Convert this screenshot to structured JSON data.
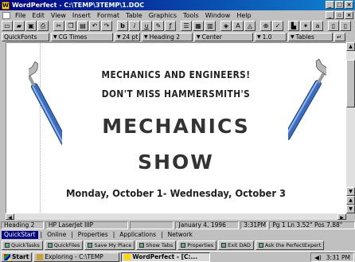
{
  "window": {
    "title": "WordPerfect - C:\\TEMP\\3TEMP\\1.DOC"
  },
  "menu": [
    "File",
    "Edit",
    "View",
    "Insert",
    "Format",
    "Table",
    "Graphics",
    "Tools",
    "Window",
    "Help"
  ],
  "propbar": {
    "quickfonts": "QuickFonts",
    "font": "CG Times",
    "size": "24 pt",
    "style": "Heading 2",
    "justify": "Center",
    "spacing": "1.0",
    "tables": "Tables"
  },
  "document": {
    "line1": "MECHANICS AND ENGINEERS!",
    "line2": "DON'T MISS HAMMERSMITH'S",
    "line3": "MECHANICS",
    "line4": "SHOW",
    "line5": "Monday, October 1- Wednesday, October 3"
  },
  "status": {
    "style": "Heading 2",
    "printer": "HP LaserJet IIIP",
    "date": "January 4, 1996",
    "time": "3:31PM",
    "position": "Pg 1 Ln 3.52\" Pos 7.88\""
  },
  "tabs": [
    "QuickStart",
    "Online",
    "Properties",
    "Applications",
    "Network"
  ],
  "quickbar": [
    "QuickTasks",
    "QuickFiles",
    "Save My Place",
    "Show Tabs",
    "Properties",
    "Exit DAD",
    "Ask the PerfectExpert"
  ],
  "taskbar": {
    "start": "Start",
    "task1": "Exploring - C:\\TEMP",
    "task2": "WordPerfect - [C:...",
    "clock": "3:31 PM"
  },
  "colors": {
    "titlebar": "#000080",
    "text": "#222222"
  }
}
